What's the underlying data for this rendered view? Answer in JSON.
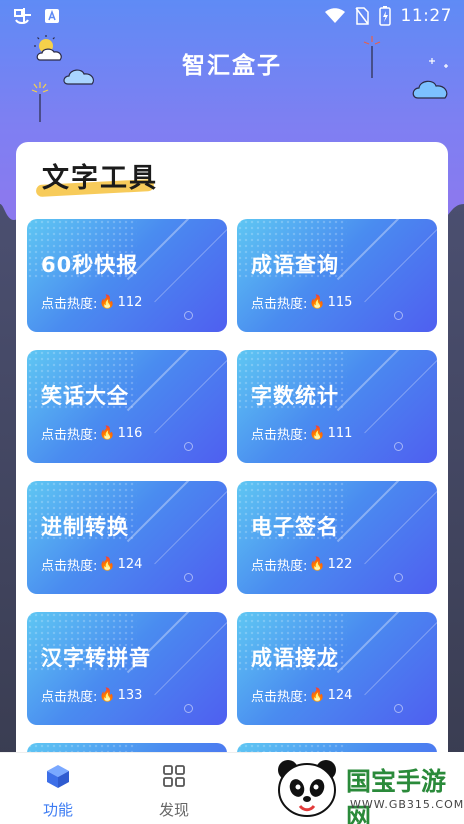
{
  "status_bar": {
    "left_icons": [
      "bug-icon",
      "a-box-icon"
    ],
    "time": "11:27",
    "right_icons": [
      "wifi-icon",
      "no-sim-icon",
      "battery-charging-icon"
    ]
  },
  "app_title": "智汇盒子",
  "section": {
    "title": "文字工具"
  },
  "tools": [
    {
      "name": "60秒快报",
      "heat_label": "点击热度:",
      "heat": "112"
    },
    {
      "name": "成语查询",
      "heat_label": "点击热度:",
      "heat": "115"
    },
    {
      "name": "笑话大全",
      "heat_label": "点击热度:",
      "heat": "116"
    },
    {
      "name": "字数统计",
      "heat_label": "点击热度:",
      "heat": "111"
    },
    {
      "name": "进制转换",
      "heat_label": "点击热度:",
      "heat": "124"
    },
    {
      "name": "电子签名",
      "heat_label": "点击热度:",
      "heat": "122"
    },
    {
      "name": "汉字转拼音",
      "heat_label": "点击热度:",
      "heat": "133"
    },
    {
      "name": "成语接龙",
      "heat_label": "点击热度:",
      "heat": "124"
    }
  ],
  "bottom_nav": {
    "items": [
      {
        "label": "功能",
        "icon": "cube-icon",
        "active": true
      },
      {
        "label": "发现",
        "icon": "grid-icon",
        "active": false
      }
    ]
  },
  "watermark": {
    "title": "国宝手游网",
    "url": "WWW.GB315.COM"
  },
  "colors": {
    "accent": "#4a7cf5",
    "active_nav": "#3d7cf3",
    "underline": "#f6c548"
  }
}
